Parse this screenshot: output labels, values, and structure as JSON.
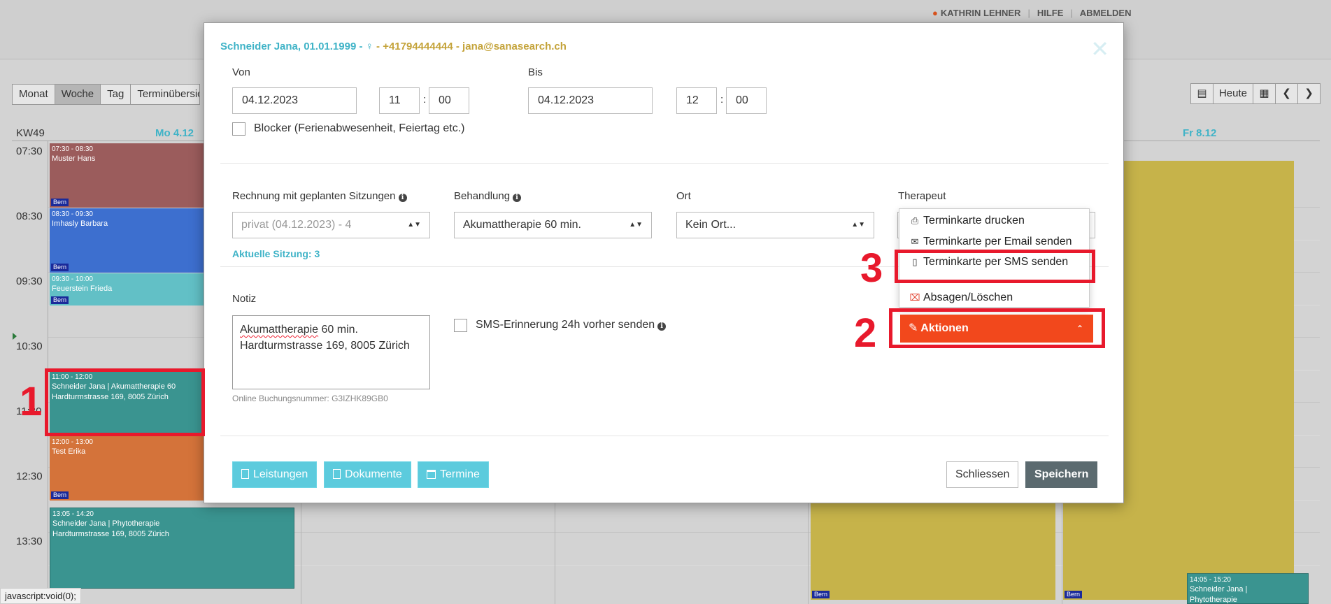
{
  "topnav": {
    "user": "KATHRIN LEHNER",
    "help": "HILFE",
    "logout": "ABMELDEN"
  },
  "views": [
    "Monat",
    "Woche",
    "Tag",
    "Terminübersicht"
  ],
  "nav": {
    "today": "Heute"
  },
  "calendar": {
    "week": "KW49",
    "day_mon": "Mo 4.12",
    "day_fri": "Fr 8.12",
    "times": [
      "07:30",
      "08:30",
      "09:30",
      "10:30",
      "11:30",
      "12:30",
      "13:30"
    ],
    "events": [
      {
        "time": "07:30 - 08:30",
        "title": "Muster Hans",
        "loc": "Bern",
        "color": "#9b5c5c"
      },
      {
        "time": "08:30 - 09:30",
        "title": "Imhasly Barbara",
        "loc": "Bern",
        "color": "#3d6fcf"
      },
      {
        "time": "09:30 - 10:00",
        "title": "Feuerstein Frieda",
        "loc": "Bern",
        "color": "#62c0c6"
      },
      {
        "time": "11:00 - 12:00",
        "title": "Schneider Jana | Akumattherapie 60",
        "line2": "Hardturmstrasse 169, 8005 Zürich",
        "color": "#3a9490"
      },
      {
        "time": "12:00 - 13:00",
        "title": "Test Erika",
        "loc": "Bern",
        "color": "#d4733a"
      },
      {
        "time": "13:05 - 14:20",
        "title": "Schneider Jana | Phytotherapie",
        "line2": "Hardturmstrasse 169, 8005 Zürich",
        "color": "#3a9490"
      },
      {
        "loc": "Bern",
        "color": "#c6b34a"
      },
      {
        "loc": "Bern",
        "color": "#c6b34a"
      },
      {
        "time": "14:05 - 15:20",
        "title": "Schneider Jana |",
        "line2": "Phytotherapie",
        "color": "#3a9490"
      }
    ]
  },
  "modal": {
    "title_name": "Schneider Jana, 01.01.1999 - ",
    "title_icon": "female-icon",
    "title_rest": " - +41794444444 - jana@sanasearch.ch",
    "von_label": "Von",
    "von_date": "04.12.2023",
    "von_hour": "11",
    "von_min": "00",
    "bis_label": "Bis",
    "bis_date": "04.12.2023",
    "bis_hour": "12",
    "bis_min": "00",
    "colon": ":",
    "blocker_label": "Blocker (Ferienabwesenheit, Feiertag etc.)",
    "rechnung_label": "Rechnung mit geplanten Sitzungen",
    "rechnung_value": "privat (04.12.2023) - 4",
    "aktuelle_sitzung": "Aktuelle Sitzung: 3",
    "behandlung_label": "Behandlung",
    "behandlung_value": "Akumattherapie 60 min.",
    "ort_label": "Ort",
    "ort_value": "Kein Ort...",
    "therapeut_label": "Therapeut",
    "notiz_label": "Notiz",
    "notiz_line1_word": "Akumattherapie",
    "notiz_line1_rest": " 60 min.",
    "notiz_line2": "Hardturmstrasse 169, 8005 Zürich",
    "booking": "Online Buchungsnummer: G3IZHK89GB0",
    "sms_label": "SMS-Erinnerung 24h vorher senden",
    "btn_leistungen": "Leistungen",
    "btn_dokumente": "Dokumente",
    "btn_termine": "Termine",
    "btn_close": "Schliessen",
    "btn_save": "Speichern"
  },
  "menu": {
    "print": "Terminkarte drucken",
    "email": "Terminkarte per Email senden",
    "sms": "Terminkarte per SMS senden",
    "cancel": "Absagen/Löschen",
    "actions": "Aktionen"
  },
  "annotations": [
    "1",
    "2",
    "3"
  ],
  "statusbar": "javascript:void(0);",
  "colors": {
    "teal": "#3fb3c7",
    "action": "#f2481c",
    "annotation": "#e8192c",
    "save": "#5b6a6f"
  }
}
